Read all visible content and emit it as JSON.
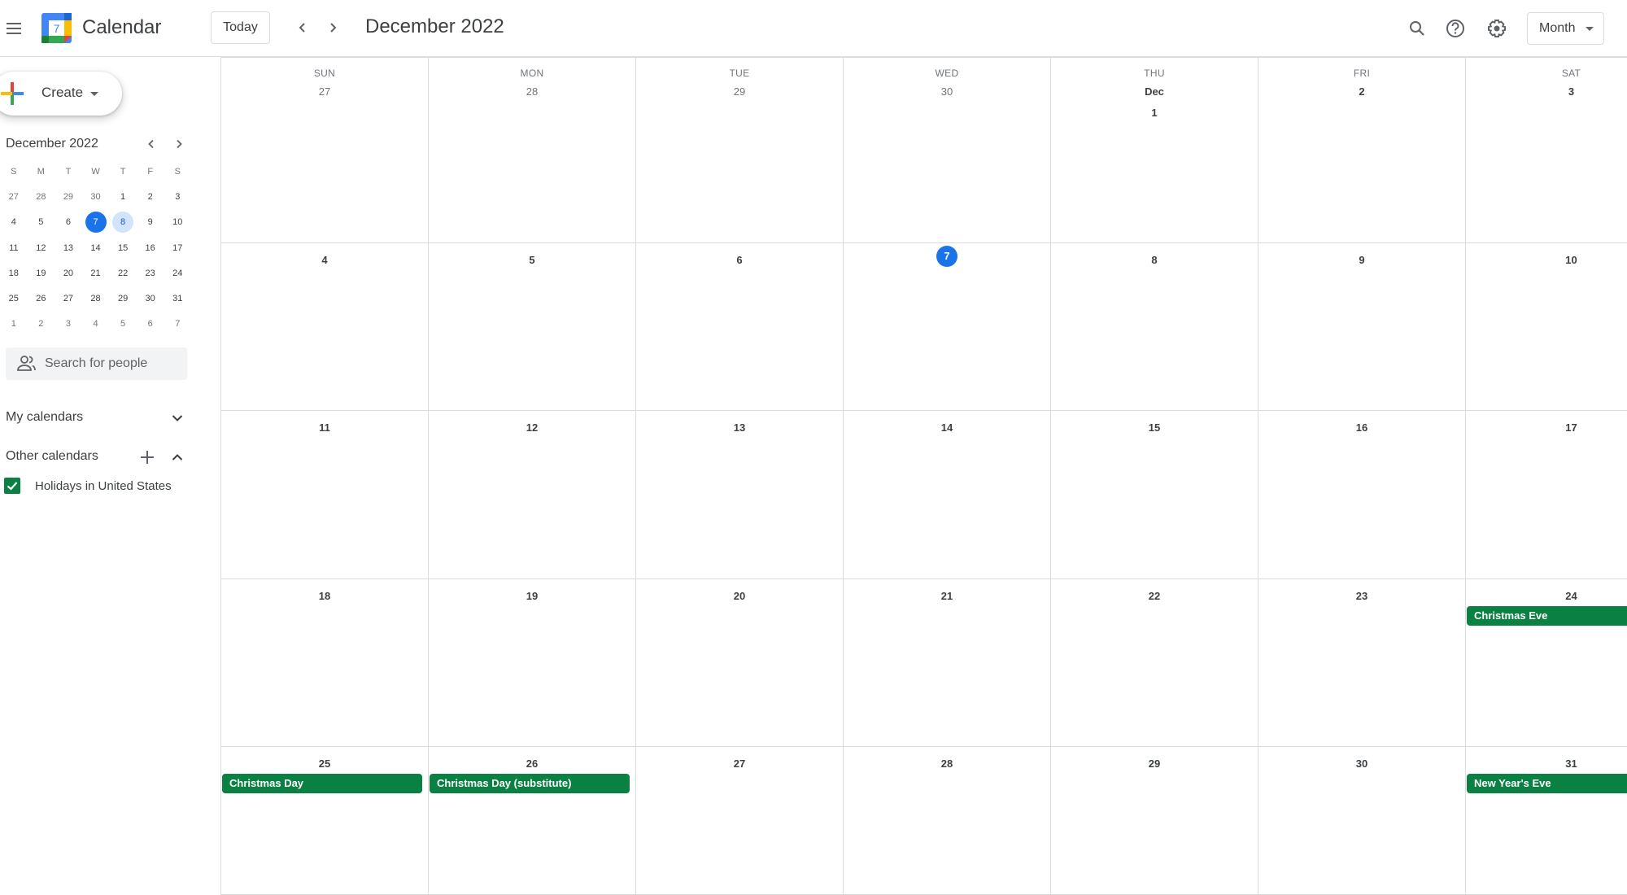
{
  "header": {
    "app_title": "Calendar",
    "logo_day": "7",
    "today_label": "Today",
    "month_title": "December 2022",
    "view_label": "Month"
  },
  "sidebar": {
    "create_label": "Create",
    "mini_title": "December 2022",
    "weekday_initials": [
      "S",
      "M",
      "T",
      "W",
      "T",
      "F",
      "S"
    ],
    "mini_weeks": [
      [
        {
          "d": "27",
          "dim": true
        },
        {
          "d": "28",
          "dim": true
        },
        {
          "d": "29",
          "dim": true
        },
        {
          "d": "30",
          "dim": true
        },
        {
          "d": "1"
        },
        {
          "d": "2"
        },
        {
          "d": "3"
        }
      ],
      [
        {
          "d": "4"
        },
        {
          "d": "5"
        },
        {
          "d": "6"
        },
        {
          "d": "7",
          "today": true
        },
        {
          "d": "8",
          "selected": true
        },
        {
          "d": "9"
        },
        {
          "d": "10"
        }
      ],
      [
        {
          "d": "11"
        },
        {
          "d": "12"
        },
        {
          "d": "13"
        },
        {
          "d": "14"
        },
        {
          "d": "15"
        },
        {
          "d": "16"
        },
        {
          "d": "17"
        }
      ],
      [
        {
          "d": "18"
        },
        {
          "d": "19"
        },
        {
          "d": "20"
        },
        {
          "d": "21"
        },
        {
          "d": "22"
        },
        {
          "d": "23"
        },
        {
          "d": "24"
        }
      ],
      [
        {
          "d": "25"
        },
        {
          "d": "26"
        },
        {
          "d": "27"
        },
        {
          "d": "28"
        },
        {
          "d": "29"
        },
        {
          "d": "30"
        },
        {
          "d": "31"
        }
      ],
      [
        {
          "d": "1",
          "dim": true
        },
        {
          "d": "2",
          "dim": true
        },
        {
          "d": "3",
          "dim": true
        },
        {
          "d": "4",
          "dim": true
        },
        {
          "d": "5",
          "dim": true
        },
        {
          "d": "6",
          "dim": true
        },
        {
          "d": "7",
          "dim": true
        }
      ]
    ],
    "people_search_placeholder": "Search for people",
    "my_calendars_label": "My calendars",
    "other_calendars_label": "Other calendars",
    "calendars": [
      {
        "label": "Holidays in United States",
        "checked": true,
        "color": "#0b8043"
      }
    ]
  },
  "month_grid": {
    "weekdays": [
      "SUN",
      "MON",
      "TUE",
      "WED",
      "THU",
      "FRI",
      "SAT"
    ],
    "weeks": [
      [
        {
          "label": "27",
          "dim": true
        },
        {
          "label": "28",
          "dim": true
        },
        {
          "label": "29",
          "dim": true
        },
        {
          "label": "30",
          "dim": true
        },
        {
          "label": "Dec 1"
        },
        {
          "label": "2"
        },
        {
          "label": "3"
        }
      ],
      [
        {
          "label": "4"
        },
        {
          "label": "5"
        },
        {
          "label": "6"
        },
        {
          "label": "7",
          "today": true
        },
        {
          "label": "8"
        },
        {
          "label": "9"
        },
        {
          "label": "10"
        }
      ],
      [
        {
          "label": "11"
        },
        {
          "label": "12"
        },
        {
          "label": "13"
        },
        {
          "label": "14"
        },
        {
          "label": "15"
        },
        {
          "label": "16"
        },
        {
          "label": "17"
        }
      ],
      [
        {
          "label": "18"
        },
        {
          "label": "19"
        },
        {
          "label": "20"
        },
        {
          "label": "21"
        },
        {
          "label": "22"
        },
        {
          "label": "23"
        },
        {
          "label": "24",
          "events": [
            "Christmas Eve"
          ]
        }
      ],
      [
        {
          "label": "25",
          "events": [
            "Christmas Day"
          ]
        },
        {
          "label": "26",
          "events": [
            "Christmas Day (substitute)"
          ]
        },
        {
          "label": "27"
        },
        {
          "label": "28"
        },
        {
          "label": "29"
        },
        {
          "label": "30"
        },
        {
          "label": "31",
          "events": [
            "New Year's Eve"
          ]
        }
      ]
    ],
    "event_color": "#0b8043",
    "today_color": "#1a73e8"
  }
}
